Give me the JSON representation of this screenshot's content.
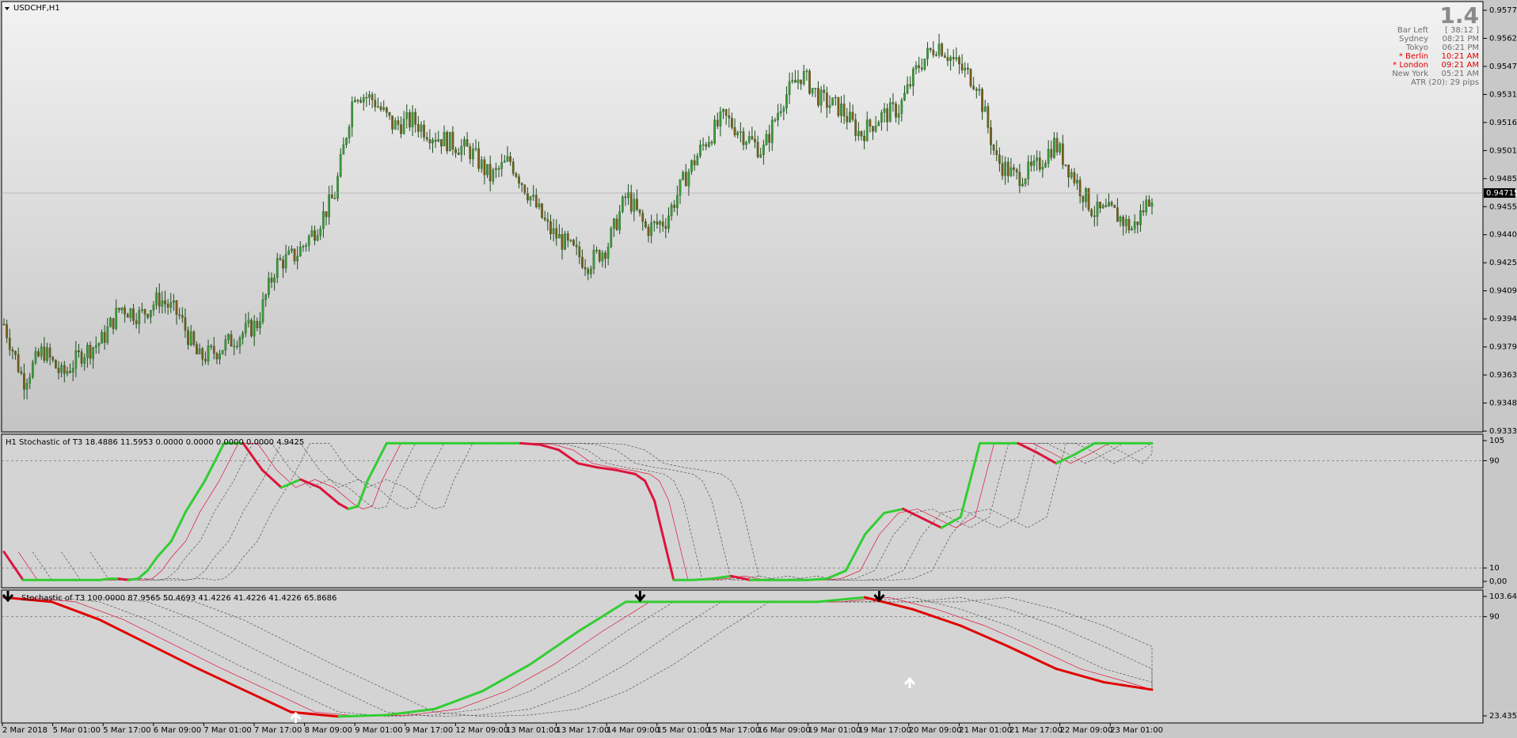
{
  "symbol_title": "USDCHF,H1",
  "current_price": "0.94715",
  "info_panel": {
    "big_value": "1.4",
    "rows": [
      {
        "label": "Bar Left",
        "value": "[ 38:12 ]",
        "highlight": false
      },
      {
        "label": "Sydney",
        "value": "08:21 PM",
        "highlight": false
      },
      {
        "label": "Tokyo",
        "value": "06:21 PM",
        "highlight": false
      },
      {
        "label": "* Berlin",
        "value": "10:21 AM",
        "highlight": true
      },
      {
        "label": "* London",
        "value": "09:21 AM",
        "highlight": true
      },
      {
        "label": "New York",
        "value": "05:21 AM",
        "highlight": false
      }
    ],
    "atr": "ATR (20): 29 pips"
  },
  "price_axis_labels": [
    "0.95770",
    "0.95620",
    "0.95470",
    "0.95315",
    "0.95165",
    "0.95010",
    "0.94855",
    "0.94550",
    "0.94400",
    "0.94250",
    "0.94095",
    "0.93945",
    "0.93790",
    "0.93635",
    "0.93485",
    "0.93330"
  ],
  "osc1_label": "H1   Stochastic of T3 18.4886 11.5953 0.0000 0.0000 0.0000 0.0000 4.9425",
  "osc1_axis_labels": [
    "105",
    "90",
    "10",
    "0,00"
  ],
  "osc2_label": "Stochastic of T3 100.0000 87.9565 50.4693 41.4226 41.4226 41.4226 65.8686",
  "osc2_axis_labels": [
    "103.6459",
    "90",
    "23.4358"
  ],
  "time_labels": [
    "2 Mar 2018",
    "5 Mar 01:00",
    "5 Mar 17:00",
    "6 Mar 09:00",
    "7 Mar 01:00",
    "7 Mar 17:00",
    "8 Mar 09:00",
    "9 Mar 01:00",
    "9 Mar 17:00",
    "12 Mar 09:00",
    "13 Mar 01:00",
    "13 Mar 17:00",
    "14 Mar 09:00",
    "15 Mar 01:00",
    "15 Mar 17:00",
    "16 Mar 09:00",
    "19 Mar 01:00",
    "19 Mar 17:00",
    "20 Mar 09:00",
    "21 Mar 01:00",
    "21 Mar 17:00",
    "22 Mar 09:00",
    "23 Mar 01:00"
  ],
  "chart_data": [
    {
      "type": "candlestick",
      "title": "USDCHF,H1",
      "ylim": [
        0.9333,
        0.9577
      ],
      "x": [
        1,
        2,
        3,
        4,
        5,
        6,
        7,
        8,
        9,
        10,
        11,
        12,
        13,
        14,
        15,
        16,
        17,
        18,
        19,
        20,
        21,
        22,
        23,
        24,
        25,
        26,
        27,
        28,
        29,
        30,
        31,
        32,
        33,
        34,
        35,
        36,
        37,
        38,
        39,
        40,
        41,
        42,
        43,
        44,
        45,
        46,
        47,
        48,
        49,
        50,
        51,
        52,
        53,
        54,
        55,
        56,
        57,
        58,
        59,
        60
      ],
      "close": [
        0.9395,
        0.9362,
        0.938,
        0.9365,
        0.9378,
        0.9385,
        0.9405,
        0.94,
        0.941,
        0.94,
        0.9375,
        0.938,
        0.9388,
        0.9395,
        0.943,
        0.9435,
        0.945,
        0.947,
        0.953,
        0.9525,
        0.951,
        0.9513,
        0.9505,
        0.95,
        0.9495,
        0.948,
        0.949,
        0.947,
        0.945,
        0.944,
        0.943,
        0.944,
        0.947,
        0.945,
        0.9455,
        0.948,
        0.95,
        0.9515,
        0.9505,
        0.9495,
        0.9525,
        0.954,
        0.9525,
        0.952,
        0.9505,
        0.9515,
        0.952,
        0.9545,
        0.9558,
        0.9545,
        0.9535,
        0.949,
        0.948,
        0.9485,
        0.95,
        0.948,
        0.946,
        0.946,
        0.945,
        0.9471
      ],
      "ylabel": ""
    },
    {
      "type": "line",
      "title": "Stochastic of T3 18.4886 11.5953 0.0000 0.0000 0.0000 0.0000 4.9425",
      "ylim": [
        0,
        105
      ],
      "levels": [
        90,
        10
      ],
      "x": [
        0,
        4,
        8,
        12,
        16,
        20,
        22,
        24,
        26,
        28,
        30,
        32,
        35,
        38,
        42,
        46,
        50,
        54,
        58,
        62,
        66,
        70,
        72,
        74,
        76,
        80,
        84,
        88,
        92,
        96,
        100,
        104,
        108,
        112,
        116,
        120,
        124,
        128,
        132,
        134,
        136,
        140,
        144,
        148,
        152,
        156,
        160,
        164,
        168,
        172,
        176,
        180,
        184,
        188,
        192,
        196,
        200,
        204,
        208,
        212,
        216,
        220,
        224,
        228,
        232,
        236,
        240
      ],
      "values": [
        22,
        1,
        1,
        1,
        1,
        1,
        2,
        2,
        1,
        2,
        8,
        18,
        30,
        52,
        75,
        103,
        103,
        83,
        70,
        76,
        70,
        58,
        54,
        56,
        75,
        103,
        103,
        103,
        103,
        103,
        103,
        103,
        103,
        102,
        98,
        88,
        85,
        83,
        80,
        75,
        60,
        1,
        1,
        2,
        4,
        1,
        1,
        1,
        1,
        2,
        8,
        35,
        51,
        54,
        47,
        40,
        48,
        103,
        103,
        103,
        96,
        88,
        95,
        103,
        103,
        103,
        103
      ],
      "series_colors": {
        "up": "#32cd32",
        "down": "#dc143c"
      }
    },
    {
      "type": "line",
      "title": "Stochastic of T3 100.0000 87.9565 50.4693 41.4226 41.4226 41.4226 65.8686",
      "ylim": [
        23.4358,
        103.6459
      ],
      "levels": [
        90
      ],
      "x": [
        0,
        10,
        20,
        30,
        40,
        50,
        60,
        70,
        80,
        90,
        100,
        110,
        120,
        130,
        140,
        150,
        160,
        170,
        180,
        190,
        200,
        210,
        220,
        230,
        240
      ],
      "values": [
        103,
        100,
        88,
        72,
        56,
        41,
        26,
        23,
        24,
        28,
        40,
        58,
        80,
        100,
        100,
        100,
        100,
        100,
        103,
        95,
        84,
        70,
        55,
        46,
        41
      ]
    }
  ]
}
